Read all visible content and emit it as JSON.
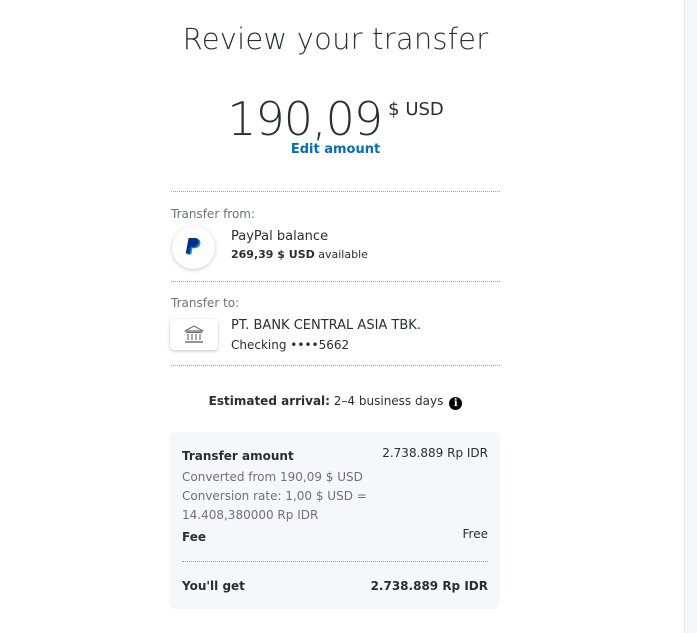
{
  "page": {
    "title": "Review your transfer"
  },
  "amount": {
    "value": "190,09",
    "currency": "$ USD",
    "edit_label": "Edit amount"
  },
  "transfer_from": {
    "label": "Transfer from:",
    "icon": "paypal-logo-icon",
    "name": "PayPal balance",
    "balance": "269,39 $ USD",
    "balance_suffix": "available"
  },
  "transfer_to": {
    "label": "Transfer to:",
    "icon": "bank-icon",
    "name": "PT. BANK CENTRAL ASIA TBK.",
    "account": "Checking ••••5662"
  },
  "arrival": {
    "label": "Estimated arrival:",
    "value": "2–4 business days",
    "icon": "info-icon"
  },
  "summary": {
    "transfer_amount_label": "Transfer amount",
    "transfer_amount_value": "2.738.889 Rp IDR",
    "converted_from": "Converted from 190,09 $ USD",
    "conversion_rate_line1": "Conversion rate: 1,00 $ USD =",
    "conversion_rate_line2": "14.408,380000 Rp IDR",
    "fee_label": "Fee",
    "fee_value": "Free",
    "you_get_label": "You'll get",
    "you_get_value": "2.738.889 Rp IDR"
  },
  "colors": {
    "link": "#0070ba",
    "paypal_dark_blue": "#003087",
    "paypal_light_blue": "#009cde",
    "text": "#2c2e2f",
    "muted": "#6c7378",
    "summary_bg": "#f5f7fa"
  }
}
